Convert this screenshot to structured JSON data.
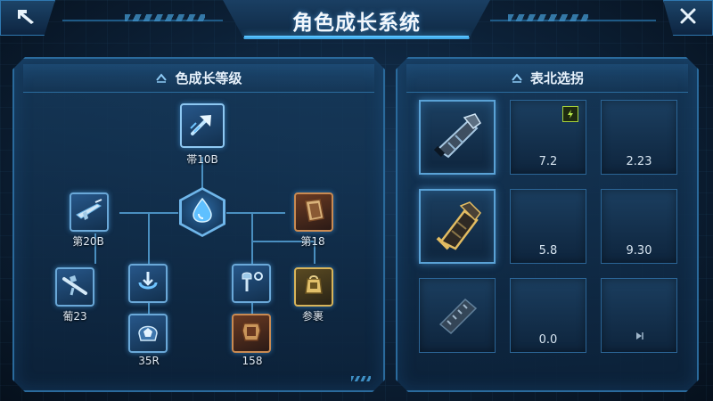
{
  "header": {
    "title": "角色成长系统"
  },
  "left_panel": {
    "title": "色成长等级",
    "nodes": {
      "top": "帯10B",
      "mid_left": "第20B",
      "mid_right": "第18",
      "bottom_1": "葡23",
      "bottom_2": "35R",
      "bottom_3": "158",
      "bottom_4": "参裹"
    }
  },
  "right_panel": {
    "title": "表北选拐",
    "slots": [
      {
        "value": ""
      },
      {
        "value": "7.2"
      },
      {
        "value": "2.23"
      },
      {
        "value": ""
      },
      {
        "value": "5.8"
      },
      {
        "value": "9.30"
      },
      {
        "value": ""
      },
      {
        "value": "0.0"
      },
      {
        "value": ""
      }
    ]
  },
  "colors": {
    "accent": "#57c2ff",
    "panel_border": "#2a6a9c",
    "badge": "#a6d23a"
  }
}
